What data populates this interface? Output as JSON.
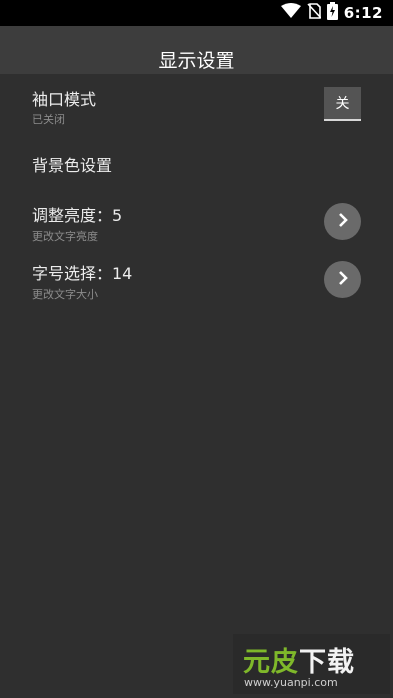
{
  "status_bar": {
    "time": "6:12",
    "icons": [
      "wifi-icon",
      "no-sim-icon",
      "battery-charging-icon"
    ]
  },
  "app_bar": {
    "title": "显示设置"
  },
  "settings": {
    "sleeve_mode": {
      "title": "袖口模式",
      "subtitle": "已关闭",
      "toggle_label": "关"
    },
    "background_color": {
      "title": "背景色设置"
    },
    "brightness": {
      "title": "调整亮度：5",
      "subtitle": "更改文字亮度",
      "icon": "chevron-right-icon"
    },
    "font_size": {
      "title": "字号选择：14",
      "subtitle": "更改文字大小",
      "icon": "chevron-right-icon"
    }
  },
  "watermark": {
    "logo_part1": "元皮",
    "logo_part2": "下载",
    "url": "www.yuanpi.com"
  },
  "colors": {
    "background": "#2f2f2f",
    "app_bar": "#3d3d3d",
    "status_bar": "#000000",
    "button": "#6a6a6a",
    "watermark_green": "#7fb82a"
  }
}
